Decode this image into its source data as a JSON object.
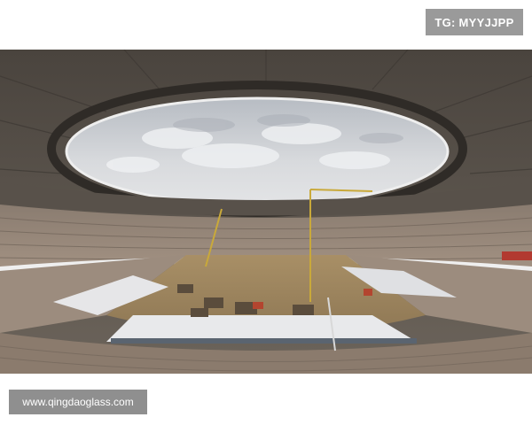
{
  "watermark_top": "TG: MYYJJPP",
  "watermark_bottom": "www.qingdaoglass.com",
  "photo": {
    "subject": "stadium-under-construction",
    "colors": {
      "roof": "#5e5750",
      "sky": "#c9ccd1",
      "seats": "#8d8074",
      "pitch": "#a58b62",
      "white_covers": "#e6e6e8"
    }
  }
}
